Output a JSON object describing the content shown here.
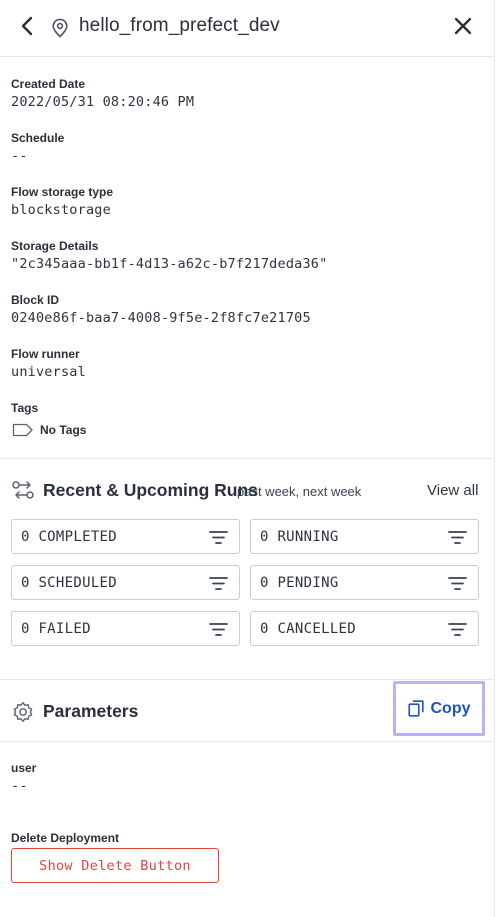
{
  "header": {
    "title": "hello_from_prefect_dev",
    "back_icon": "chevron-left-icon",
    "location_icon": "map-pin-icon",
    "close_icon": "close-icon"
  },
  "details": {
    "created_label": "Created Date",
    "created_value": "2022/05/31 08:20:46 PM",
    "schedule_label": "Schedule",
    "schedule_value": "--",
    "storage_type_label": "Flow storage type",
    "storage_type_value": "blockstorage",
    "storage_details_label": "Storage Details",
    "storage_details_value": "\"2c345aaa-bb1f-4d13-a62c-b7f217deda36\"",
    "block_id_label": "Block ID",
    "block_id_value": "0240e86f-baa7-4008-9f5e-2f8fc7e21705",
    "flow_runner_label": "Flow runner",
    "flow_runner_value": "universal",
    "tags_label": "Tags",
    "tags_value": "No Tags"
  },
  "runs": {
    "title": "Recent & Upcoming Runs",
    "subtitle": "past week, next week",
    "view_all": "View all",
    "states": [
      {
        "label": "0 COMPLETED"
      },
      {
        "label": "0 RUNNING"
      },
      {
        "label": "0 SCHEDULED"
      },
      {
        "label": "0 PENDING"
      },
      {
        "label": "0 FAILED"
      },
      {
        "label": "0 CANCELLED"
      }
    ]
  },
  "parameters": {
    "title": "Parameters",
    "copy_label": "Copy",
    "user_label": "user",
    "user_value": "--"
  },
  "delete": {
    "label": "Delete Deployment",
    "button": "Show Delete Button"
  },
  "colors": {
    "accent_blue": "#1f53c4",
    "danger_red": "#e0453a",
    "focus_ring": "#b7b3f5"
  }
}
